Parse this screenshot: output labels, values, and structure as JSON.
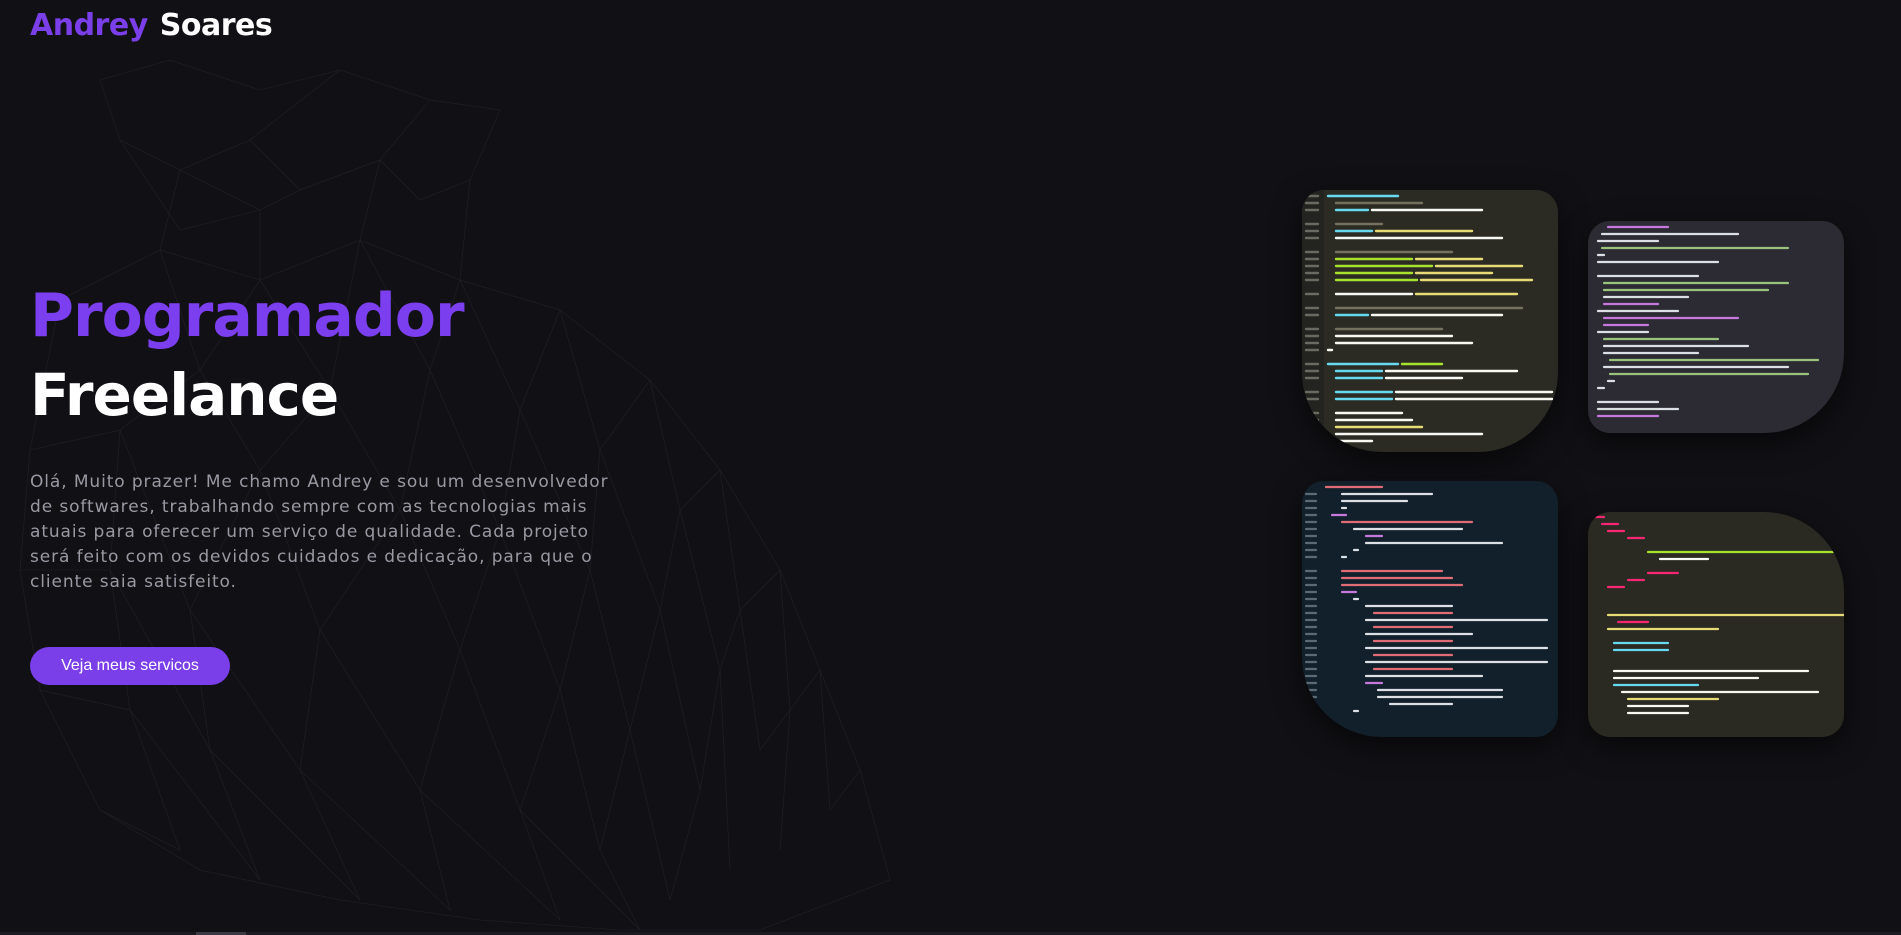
{
  "header": {
    "logo_first": "Andrey",
    "logo_last": "Soares"
  },
  "hero": {
    "title_line1": "Programador",
    "title_line2": "Freelance",
    "description": "Olá, Muito prazer! Me chamo Andrey e sou um desenvolvedor de softwares, trabalhando sempre com as tecnologias mais atuais para oferecer um serviço de qualidade. Cada projeto será feito com os devidos cuidados e dedicação, para que o cliente saia satisfeito.",
    "cta_label": "Veja meus servicos"
  },
  "colors": {
    "accent": "#7c3ff0",
    "background": "#111014",
    "text_muted": "#9a98a3"
  },
  "gallery": {
    "cards": [
      {
        "name": "code-screenshot-1",
        "theme": "#2b2b24"
      },
      {
        "name": "code-screenshot-2",
        "theme": "#2c2b34"
      },
      {
        "name": "code-screenshot-3",
        "theme": "#12202b"
      },
      {
        "name": "code-screenshot-4",
        "theme": "#2a2a23"
      }
    ]
  }
}
